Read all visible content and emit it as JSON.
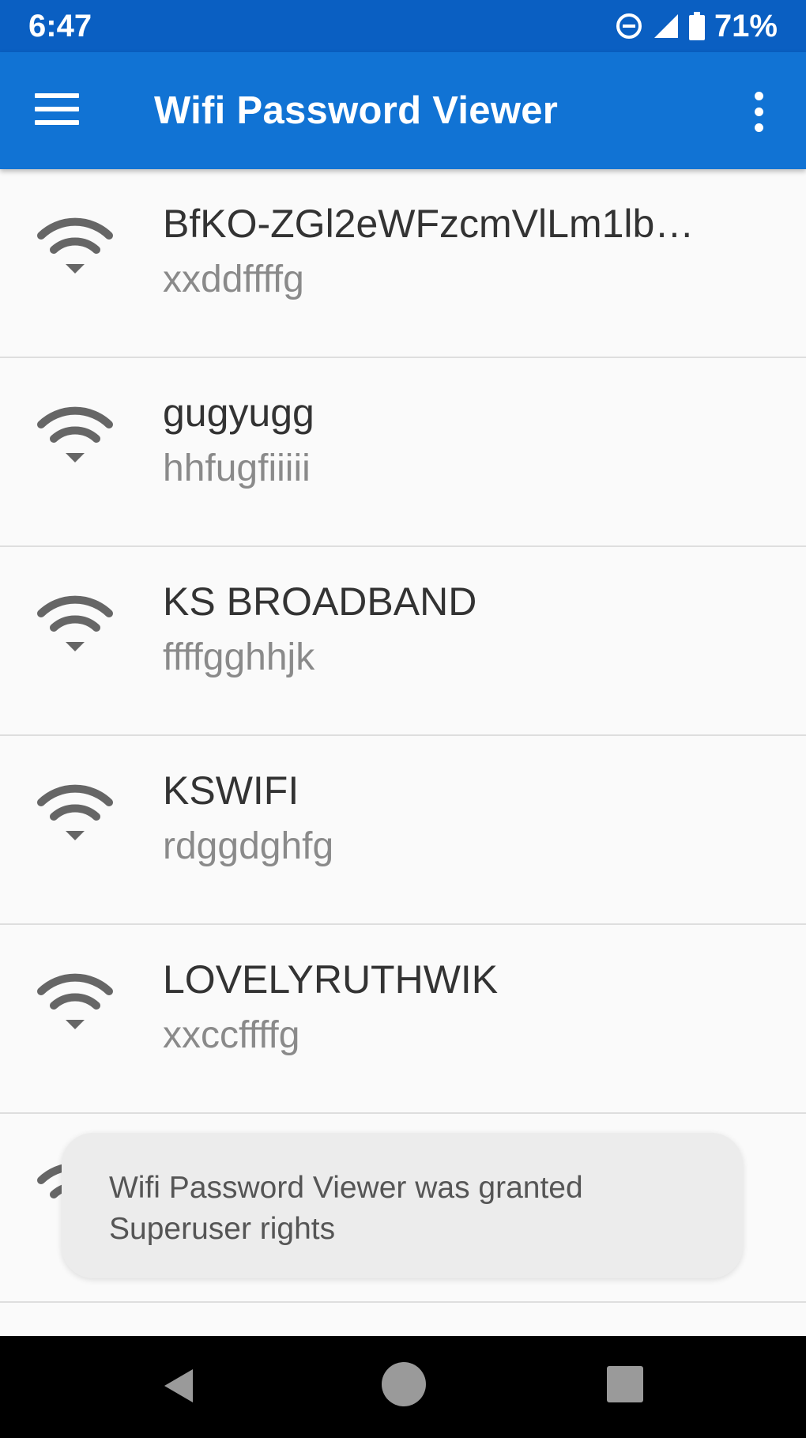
{
  "status_bar": {
    "time": "6:47",
    "battery_percent": "71%",
    "icons": [
      "dnd-icon",
      "signal-icon",
      "battery-icon"
    ]
  },
  "app_bar": {
    "title": "Wifi Password Viewer",
    "menu_icon": "hamburger-menu-icon",
    "overflow_icon": "more-vert-icon"
  },
  "networks": [
    {
      "ssid": "BfKO-ZGl2eWFzcmVlLm1lb…",
      "password": "xxddffffg"
    },
    {
      "ssid": "gugyugg",
      "password": "hhfugfiiiii"
    },
    {
      "ssid": "KS BROADBAND",
      "password": "ffffgghhjk"
    },
    {
      "ssid": "KSWIFI",
      "password": "rdggdghfg"
    },
    {
      "ssid": "LOVELYRUTHWIK",
      "password": "xxccffffg"
    },
    {
      "ssid": "",
      "password": ""
    }
  ],
  "toast": {
    "line1": "Wifi Password Viewer was granted",
    "line2": "Superuser rights"
  },
  "colors": {
    "status_bar": "#0a5fc2",
    "app_bar": "#1173d4",
    "background": "#fafafa",
    "icon_gray": "#666666"
  }
}
